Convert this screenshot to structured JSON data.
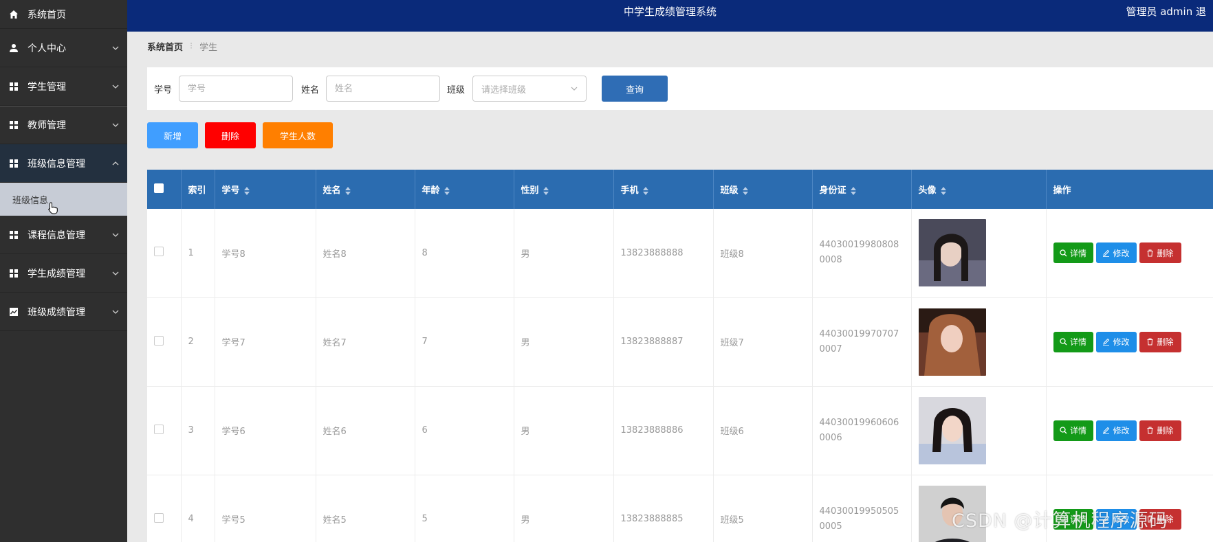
{
  "sidebar": {
    "items": [
      {
        "label": "系统首页",
        "icon": "home-icon"
      },
      {
        "label": "个人中心",
        "icon": "user-icon"
      },
      {
        "label": "学生管理",
        "icon": "grid-icon"
      },
      {
        "label": "教师管理",
        "icon": "grid-icon"
      },
      {
        "label": "班级信息管理",
        "icon": "grid-icon"
      },
      {
        "label": "课程信息管理",
        "icon": "grid-icon"
      },
      {
        "label": "学生成绩管理",
        "icon": "grid-icon"
      },
      {
        "label": "班级成绩管理",
        "icon": "chart-icon"
      }
    ],
    "submenu": {
      "label": "班级信息"
    }
  },
  "header": {
    "title": "中学生成绩管理系统",
    "user": "管理员 admin  退"
  },
  "breadcrumb": {
    "home": "系统首页",
    "current": "学生"
  },
  "search": {
    "student_no_label": "学号",
    "student_no_placeholder": "学号",
    "name_label": "姓名",
    "name_placeholder": "姓名",
    "class_label": "班级",
    "class_placeholder": "请选择班级",
    "query_label": "查询"
  },
  "actions": {
    "add_label": "新增",
    "delete_label": "删除",
    "count_label": "学生人数"
  },
  "table": {
    "headers": {
      "index": "索引",
      "student_no": "学号",
      "name": "姓名",
      "age": "年龄",
      "gender": "性别",
      "phone": "手机",
      "class": "班级",
      "id_card": "身份证",
      "avatar": "头像",
      "ops": "操作"
    },
    "op_labels": {
      "detail": "详情",
      "edit": "修改",
      "delete": "删除"
    },
    "rows": [
      {
        "index": "1",
        "student_no": "学号8",
        "name": "姓名8",
        "age": "8",
        "gender": "男",
        "phone": "13823888888",
        "class": "班级8",
        "id_card": "440300199808080008"
      },
      {
        "index": "2",
        "student_no": "学号7",
        "name": "姓名7",
        "age": "7",
        "gender": "男",
        "phone": "13823888887",
        "class": "班级7",
        "id_card": "440300199707070007"
      },
      {
        "index": "3",
        "student_no": "学号6",
        "name": "姓名6",
        "age": "6",
        "gender": "男",
        "phone": "13823888886",
        "class": "班级6",
        "id_card": "440300199606060006"
      },
      {
        "index": "4",
        "student_no": "学号5",
        "name": "姓名5",
        "age": "5",
        "gender": "男",
        "phone": "13823888885",
        "class": "班级5",
        "id_card": "440300199505050005"
      }
    ]
  },
  "watermark": "CSDN @计算机程序源码",
  "colors": {
    "header_bg": "#0a2a7a",
    "sidebar_bg": "#2f2f2f",
    "table_header_bg": "#2b6cb0",
    "add_btn": "#409eff",
    "delete_btn": "#ff0000",
    "count_btn": "#ff7f00",
    "detail_btn": "#139a18",
    "edit_btn": "#1e8ee8",
    "row_delete_btn": "#c53030"
  }
}
